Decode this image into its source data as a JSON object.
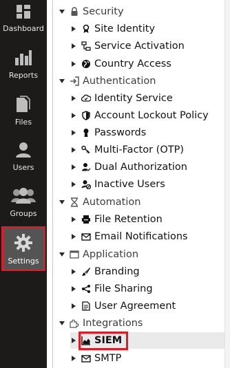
{
  "rail": {
    "items": [
      {
        "label": "Dashboard",
        "icon": "dashboard-icon"
      },
      {
        "label": "Reports",
        "icon": "reports-icon"
      },
      {
        "label": "Files",
        "icon": "files-icon"
      },
      {
        "label": "Users",
        "icon": "users-icon"
      },
      {
        "label": "Groups",
        "icon": "groups-icon"
      },
      {
        "label": "Settings",
        "icon": "gear-icon",
        "active": true
      }
    ]
  },
  "tree": {
    "sections": [
      {
        "label": "Security",
        "icon": "lock-icon",
        "expanded": true,
        "items": [
          "Site Identity",
          "Service Activation",
          "Country Access"
        ]
      },
      {
        "label": "Authentication",
        "icon": "sign-in-icon",
        "expanded": true,
        "items": [
          "Identity Service",
          "Account Lockout Policy",
          "Passwords",
          "Multi-Factor (OTP)",
          "Dual Authorization",
          "Inactive Users"
        ]
      },
      {
        "label": "Automation",
        "icon": "hourglass-icon",
        "expanded": true,
        "items": [
          "File Retention",
          "Email Notifications"
        ]
      },
      {
        "label": "Application",
        "icon": "window-icon",
        "expanded": true,
        "items": [
          "Branding",
          "File Sharing",
          "User Agreement"
        ]
      },
      {
        "label": "Integrations",
        "icon": "puzzle-icon",
        "expanded": true,
        "items": [
          "SIEM",
          "SMTP"
        ]
      }
    ],
    "selected_item": "SIEM"
  },
  "colors": {
    "rail_bg": "#1d1b1a",
    "active_bg": "#545454",
    "highlight_border": "#e01b24",
    "selected_row_bg": "#eaeaea"
  }
}
